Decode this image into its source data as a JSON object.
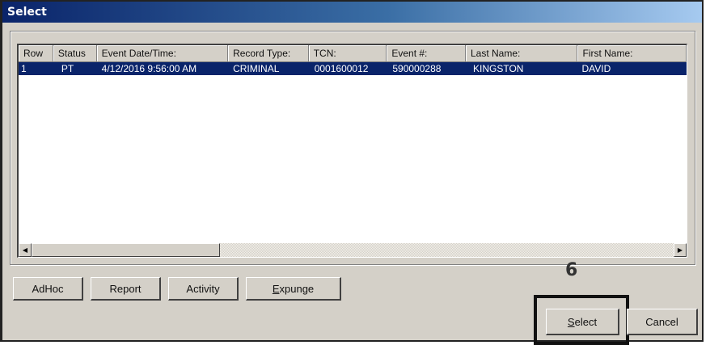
{
  "window": {
    "title": "Select"
  },
  "table": {
    "columns": [
      "Row",
      "Status",
      "Event Date/Time:",
      "Record Type:",
      "TCN:",
      "Event #:",
      "Last Name:",
      "First Name:"
    ],
    "rows": [
      {
        "row": "1",
        "status": "PT",
        "event_datetime": "4/12/2016 9:56:00 AM",
        "record_type": "CRIMINAL",
        "tcn": "0001600012",
        "event_no": "590000288",
        "last_name": "KINGSTON",
        "first_name": "DAVID"
      }
    ],
    "selected_row_color": "#0a246a"
  },
  "buttons": {
    "adhoc": "AdHoc",
    "report": "Report",
    "activity": "Activity",
    "expunge_prefix": "",
    "expunge_accel": "E",
    "expunge_rest": "xpunge",
    "select_accel": "S",
    "select_rest": "elect",
    "cancel": "Cancel"
  },
  "annotation": {
    "step_number": "6"
  },
  "icons": {
    "scroll_left": "scroll-left-arrow-icon",
    "scroll_right": "scroll-right-arrow-icon"
  }
}
